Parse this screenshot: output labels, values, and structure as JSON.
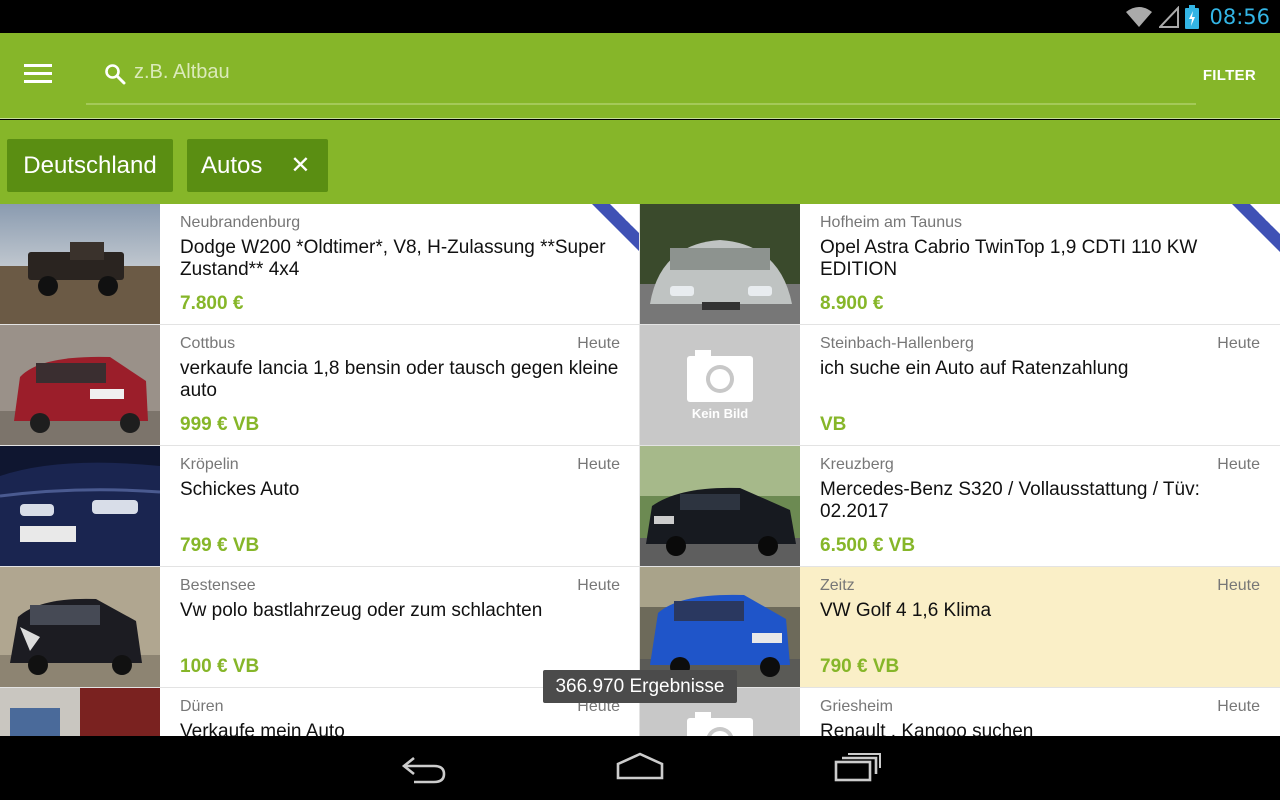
{
  "status": {
    "time": "08:56"
  },
  "appbar": {
    "search_placeholder": "z.B. Altbau",
    "filter_label": "FILTER"
  },
  "chips": [
    {
      "label": "Deutschland"
    },
    {
      "label": "Autos"
    }
  ],
  "listings": [
    {
      "location": "Neubrandenburg",
      "date": "",
      "title": "Dodge W200 *Oldtimer*, V8, H-Zulassung **Super Zustand** 4x4",
      "price": "7.800 €",
      "badge": "TOP",
      "photo": true
    },
    {
      "location": "Hofheim am Taunus",
      "date": "",
      "title": "Opel Astra Cabrio TwinTop 1,9 CDTI 110 KW EDITION",
      "price": "8.900 €",
      "badge": "TOP",
      "photo": true
    },
    {
      "location": "Cottbus",
      "date": "Heute",
      "title": "verkaufe lancia 1,8 bensin oder tausch gegen kleine auto",
      "price": "999 € VB",
      "photo": true
    },
    {
      "location": "Steinbach-Hallenberg",
      "date": "Heute",
      "title": "ich suche ein Auto auf Ratenzahlung",
      "price": "VB",
      "photo": false,
      "no_image_label": "Kein Bild"
    },
    {
      "location": "Kröpelin",
      "date": "Heute",
      "title": "Schickes Auto",
      "price": "799 € VB",
      "photo": true
    },
    {
      "location": "Kreuzberg",
      "date": "Heute",
      "title": "Mercedes-Benz S320 / Vollausstattung / Tüv: 02.2017",
      "price": "6.500 € VB",
      "photo": true
    },
    {
      "location": "Bestensee",
      "date": "Heute",
      "title": "Vw polo bastlahrzeug oder zum schlachten",
      "price": "100 € VB",
      "photo": true
    },
    {
      "location": "Zeitz",
      "date": "Heute",
      "title": "VW Golf 4 1,6 Klima",
      "price": "790 € VB",
      "photo": true,
      "highlight": true
    },
    {
      "location": "Düren",
      "date": "Heute",
      "title": "Verkaufe mein Auto",
      "price": "",
      "photo": true
    },
    {
      "location": "Griesheim",
      "date": "Heute",
      "title": "Renault , Kangoo suchen",
      "price": "",
      "photo": false
    }
  ],
  "toast": {
    "text": "366.970 Ergebnisse"
  },
  "colors": {
    "brand_green": "#86b629",
    "chip_green": "#5a8e12",
    "top_badge": "#3f51b5",
    "highlight": "#faefc7"
  }
}
